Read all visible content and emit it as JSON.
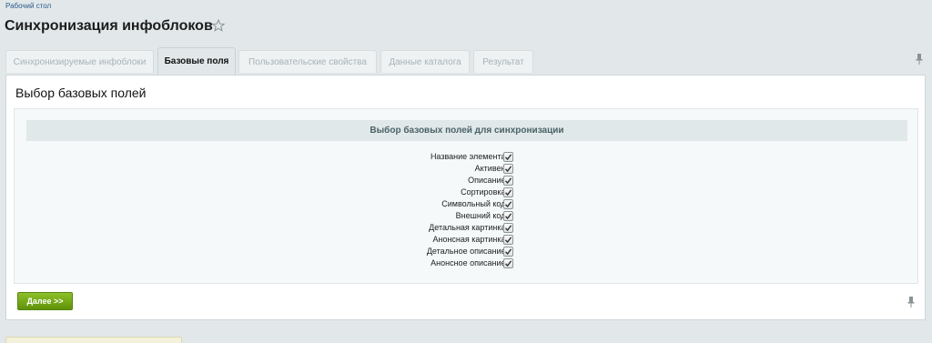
{
  "breadcrumb": "Рабочий стол",
  "title": "Синхронизация инфоблоков",
  "tabs": [
    {
      "label": "Синхронизируемые инфоблоки",
      "active": false
    },
    {
      "label": "Базовые поля",
      "active": true
    },
    {
      "label": "Пользовательские свойства",
      "active": false
    },
    {
      "label": "Данные каталога",
      "active": false
    },
    {
      "label": "Результат",
      "active": false
    }
  ],
  "panel": {
    "title": "Выбор базовых полей",
    "section_header": "Выбор базовых полей для синхронизации",
    "fields": [
      {
        "label": "Название элемента:",
        "checked": true
      },
      {
        "label": "Активен:",
        "checked": true
      },
      {
        "label": "Описание:",
        "checked": true
      },
      {
        "label": "Сортировка:",
        "checked": true
      },
      {
        "label": "Символьный код:",
        "checked": true
      },
      {
        "label": "Внешний код:",
        "checked": true
      },
      {
        "label": "Детальная картинка:",
        "checked": true
      },
      {
        "label": "Анонсная картинка:",
        "checked": true
      },
      {
        "label": "Детальное описание:",
        "checked": true
      },
      {
        "label": "Анонсное описание:",
        "checked": true
      }
    ],
    "next_button": "Далее >>"
  },
  "icons": {
    "favorite": "star-icon",
    "pin": "pin-icon",
    "check": "checkmark-icon"
  },
  "colors": {
    "button_green": "#6ea315",
    "background": "#e2e8ea"
  }
}
